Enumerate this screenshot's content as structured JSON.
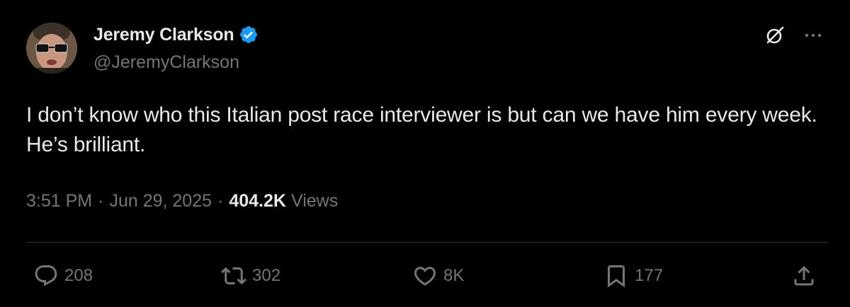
{
  "author": {
    "display_name": "Jeremy Clarkson",
    "handle": "@JeremyClarkson",
    "verified": true,
    "avatar_icon": "avatar-photo"
  },
  "tweet": {
    "text": "I don’t know who this Italian post race interviewer is but can we have him every week. He’s brilliant.",
    "time": "3:51 PM",
    "date": "Jun 29, 2025",
    "separator": "·",
    "views_count": "404.2K",
    "views_label": "Views"
  },
  "actions": {
    "replies": "208",
    "reposts": "302",
    "likes": "8K",
    "bookmarks": "177"
  },
  "icons": {
    "top": [
      "grok-icon",
      "more-icon"
    ],
    "bar": [
      "reply-icon",
      "repost-icon",
      "like-icon",
      "bookmark-icon",
      "share-icon"
    ]
  },
  "colors": {
    "background": "#000000",
    "text_primary": "#e7e9ea",
    "text_secondary": "#71767b",
    "verified_blue": "#1d9bf0",
    "divider": "#2f3336"
  }
}
